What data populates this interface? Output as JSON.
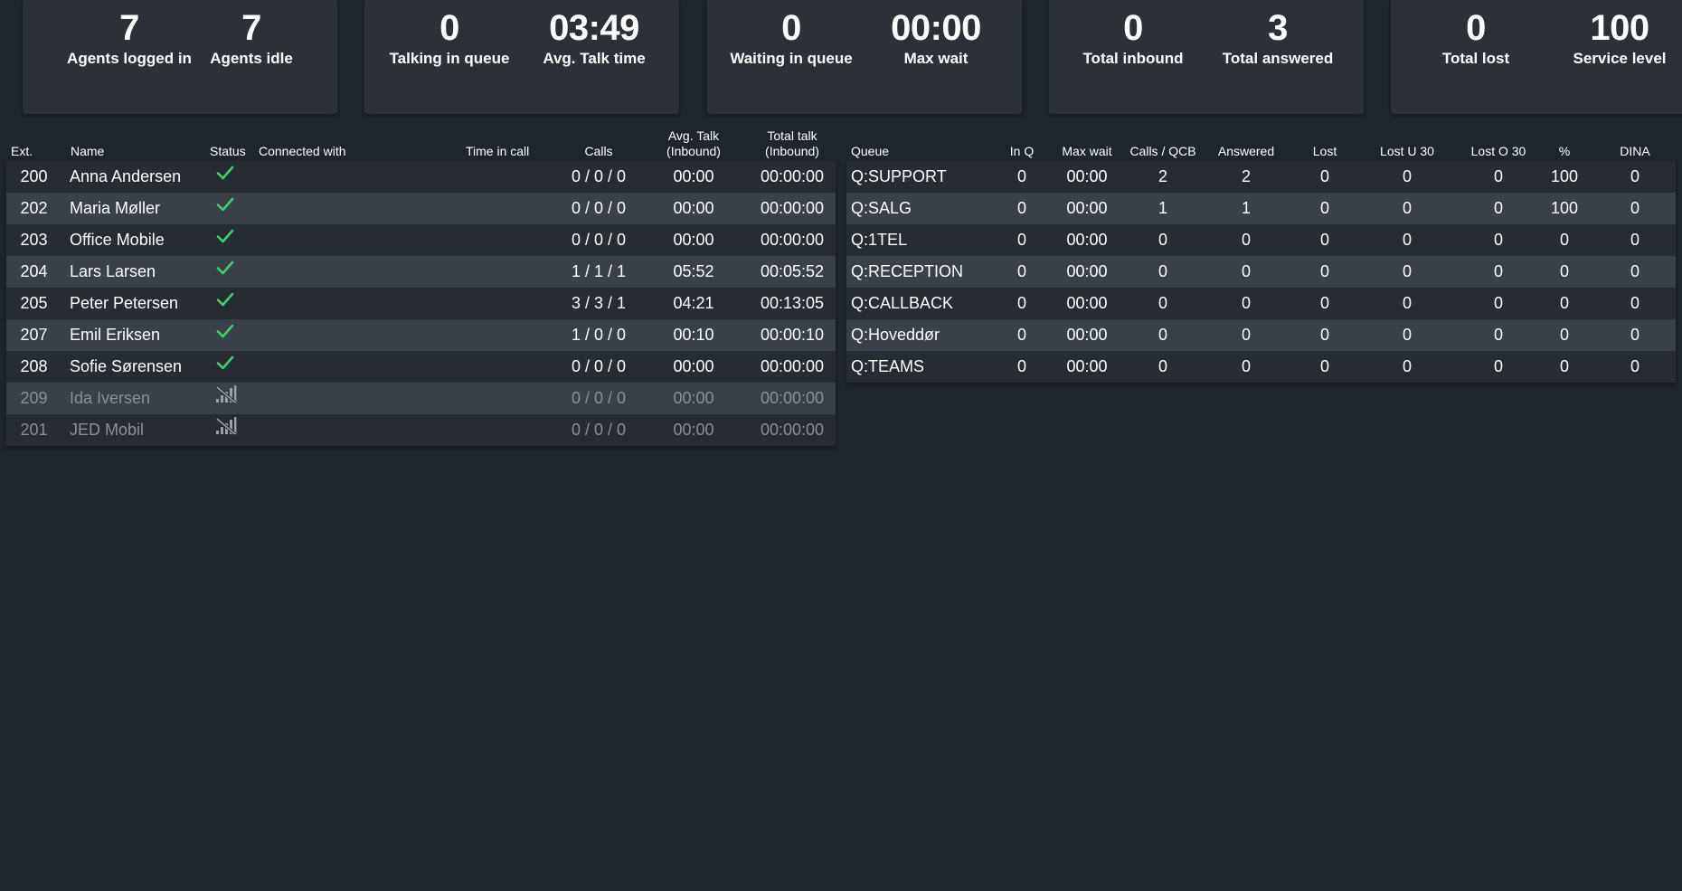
{
  "cards": [
    {
      "stats": [
        {
          "value": "7",
          "label": "Agents logged in"
        },
        {
          "value": "7",
          "label": "Agents idle"
        }
      ]
    },
    {
      "stats": [
        {
          "value": "0",
          "label": "Talking in queue"
        },
        {
          "value": "03:49",
          "label": "Avg. Talk time"
        }
      ]
    },
    {
      "stats": [
        {
          "value": "0",
          "label": "Waiting in queue"
        },
        {
          "value": "00:00",
          "label": "Max wait"
        }
      ]
    },
    {
      "stats": [
        {
          "value": "0",
          "label": "Total inbound"
        },
        {
          "value": "3",
          "label": "Total answered"
        }
      ]
    },
    {
      "stats": [
        {
          "value": "0",
          "label": "Total lost"
        },
        {
          "value": "100",
          "label": "Service level"
        }
      ]
    }
  ],
  "agents": {
    "headers": {
      "ext": "Ext.",
      "name": "Name",
      "status": "Status",
      "connected": "Connected with",
      "time_in_call": "Time in call",
      "calls": "Calls",
      "avg_talk_1": "Avg. Talk",
      "avg_talk_2": "(Inbound)",
      "total_talk_1": "Total talk",
      "total_talk_2": "(Inbound)"
    },
    "rows": [
      {
        "ext": "200",
        "name": "Anna Andersen",
        "status": "available",
        "connected": "",
        "time": "",
        "calls": "0 / 0 / 0",
        "avg": "00:00",
        "total": "00:00:00"
      },
      {
        "ext": "202",
        "name": "Maria Møller",
        "status": "available",
        "connected": "",
        "time": "",
        "calls": "0 / 0 / 0",
        "avg": "00:00",
        "total": "00:00:00"
      },
      {
        "ext": "203",
        "name": "Office Mobile",
        "status": "available",
        "connected": "",
        "time": "",
        "calls": "0 / 0 / 0",
        "avg": "00:00",
        "total": "00:00:00"
      },
      {
        "ext": "204",
        "name": "Lars Larsen",
        "status": "available",
        "connected": "",
        "time": "",
        "calls": "1 / 1 / 1",
        "avg": "05:52",
        "total": "00:05:52"
      },
      {
        "ext": "205",
        "name": "Peter Petersen",
        "status": "available",
        "connected": "",
        "time": "",
        "calls": "3 / 3 / 1",
        "avg": "04:21",
        "total": "00:13:05"
      },
      {
        "ext": "207",
        "name": "Emil Eriksen",
        "status": "available",
        "connected": "",
        "time": "",
        "calls": "1 / 0 / 0",
        "avg": "00:10",
        "total": "00:00:10"
      },
      {
        "ext": "208",
        "name": "Sofie Sørensen",
        "status": "available",
        "connected": "",
        "time": "",
        "calls": "0 / 0 / 0",
        "avg": "00:00",
        "total": "00:00:00"
      },
      {
        "ext": "209",
        "name": "Ida Iversen",
        "status": "no-signal",
        "connected": "",
        "time": "",
        "calls": "0 / 0 / 0",
        "avg": "00:00",
        "total": "00:00:00"
      },
      {
        "ext": "201",
        "name": "JED Mobil",
        "status": "no-signal",
        "connected": "",
        "time": "",
        "calls": "0 / 0 / 0",
        "avg": "00:00",
        "total": "00:00:00"
      }
    ]
  },
  "queues": {
    "headers": {
      "queue": "Queue",
      "in_q": "In Q",
      "max_wait": "Max wait",
      "calls_qcb": "Calls / QCB",
      "answered": "Answered",
      "lost": "Lost",
      "lost_u30": "Lost U 30",
      "lost_o30": "Lost O 30",
      "pct": "%",
      "dina": "DINA"
    },
    "rows": [
      {
        "queue": "Q:SUPPORT",
        "in_q": "0",
        "max_wait": "00:00",
        "calls_qcb": "2",
        "answered": "2",
        "lost": "0",
        "lost_u30": "0",
        "lost_o30": "0",
        "pct": "100",
        "dina": "0"
      },
      {
        "queue": "Q:SALG",
        "in_q": "0",
        "max_wait": "00:00",
        "calls_qcb": "1",
        "answered": "1",
        "lost": "0",
        "lost_u30": "0",
        "lost_o30": "0",
        "pct": "100",
        "dina": "0"
      },
      {
        "queue": "Q:1TEL",
        "in_q": "0",
        "max_wait": "00:00",
        "calls_qcb": "0",
        "answered": "0",
        "lost": "0",
        "lost_u30": "0",
        "lost_o30": "0",
        "pct": "0",
        "dina": "0"
      },
      {
        "queue": "Q:RECEPTION",
        "in_q": "0",
        "max_wait": "00:00",
        "calls_qcb": "0",
        "answered": "0",
        "lost": "0",
        "lost_u30": "0",
        "lost_o30": "0",
        "pct": "0",
        "dina": "0"
      },
      {
        "queue": "Q:CALLBACK",
        "in_q": "0",
        "max_wait": "00:00",
        "calls_qcb": "0",
        "answered": "0",
        "lost": "0",
        "lost_u30": "0",
        "lost_o30": "0",
        "pct": "0",
        "dina": "0"
      },
      {
        "queue": "Q:Hoveddør",
        "in_q": "0",
        "max_wait": "00:00",
        "calls_qcb": "0",
        "answered": "0",
        "lost": "0",
        "lost_u30": "0",
        "lost_o30": "0",
        "pct": "0",
        "dina": "0"
      },
      {
        "queue": "Q:TEAMS",
        "in_q": "0",
        "max_wait": "00:00",
        "calls_qcb": "0",
        "answered": "0",
        "lost": "0",
        "lost_u30": "0",
        "lost_o30": "0",
        "pct": "0",
        "dina": "0"
      }
    ]
  },
  "colors": {
    "background": "#1f252c",
    "card": "#2b3137",
    "row_alt": "#3a4047",
    "available": "#3ecf6e",
    "offline_text": "#8b9096"
  },
  "icons": {
    "available": "checkmark-icon",
    "no-signal": "no-signal-icon"
  }
}
